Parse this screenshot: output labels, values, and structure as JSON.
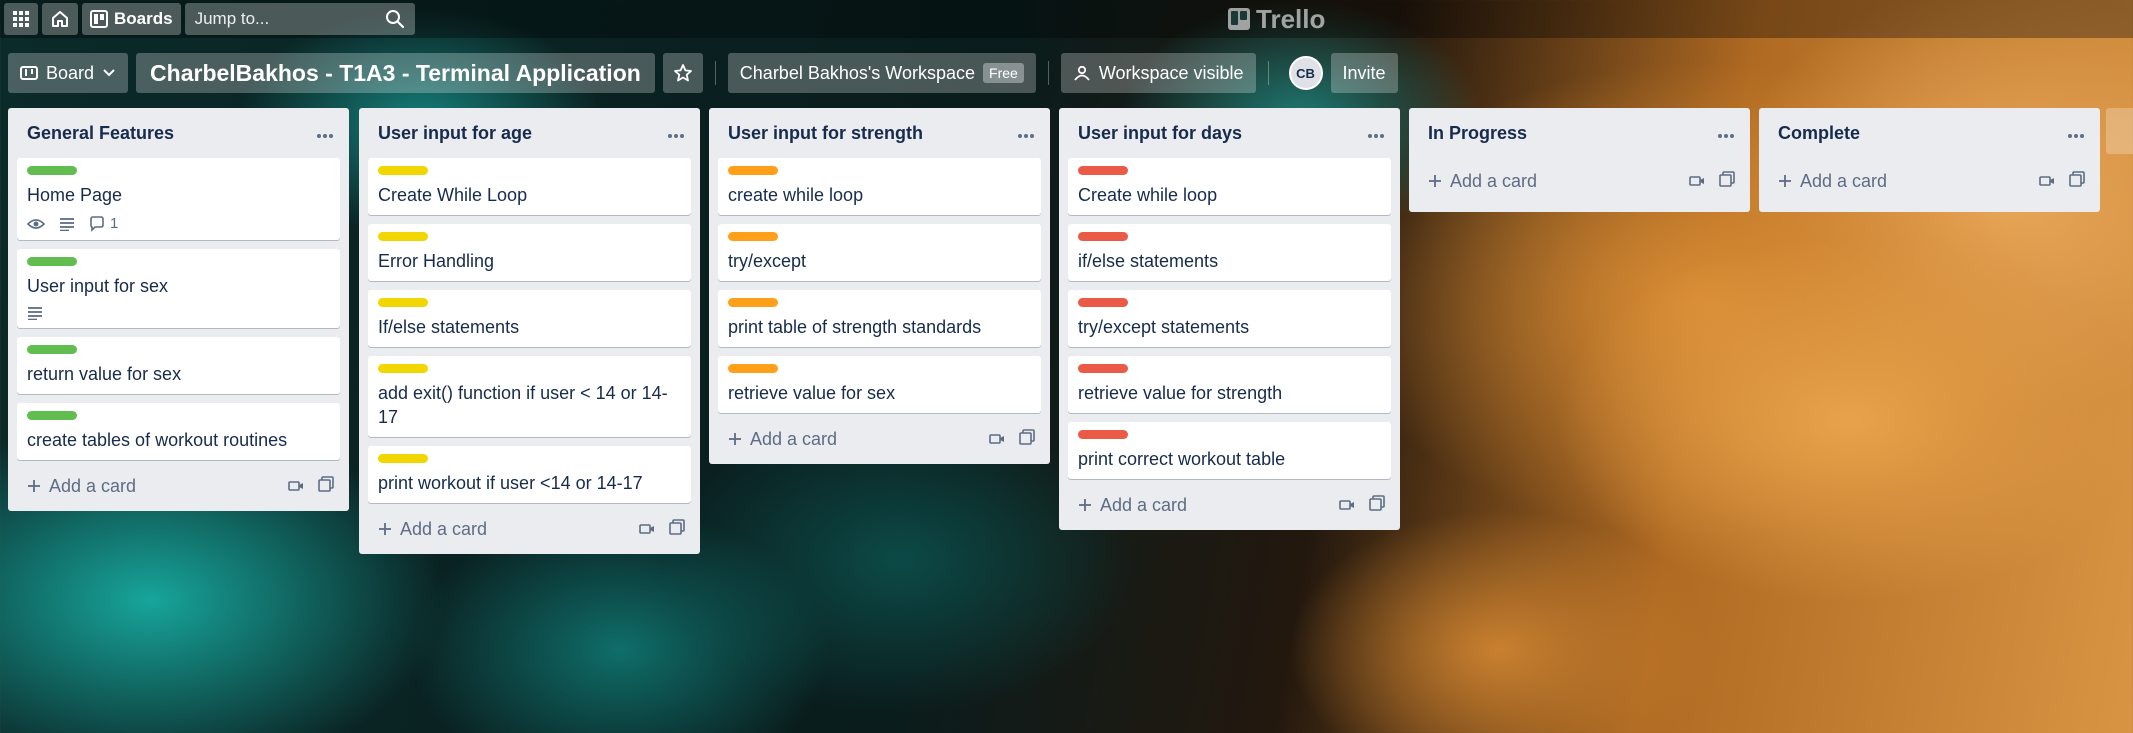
{
  "topbar": {
    "boards_label": "Boards",
    "search_placeholder": "Jump to...",
    "brand": "Trello"
  },
  "boardbar": {
    "view_label": "Board",
    "board_title": "CharbelBakhos - T1A3 - Terminal Application",
    "workspace_name": "Charbel Bakhos's Workspace",
    "workspace_plan": "Free",
    "visibility_label": "Workspace visible",
    "avatar_initials": "CB",
    "invite_label": "Invite"
  },
  "add_card_label": "Add a card",
  "colors": {
    "green": "#61bd4f",
    "yellow": "#f2d600",
    "orange": "#ff9f1a",
    "red": "#eb5a46"
  },
  "lists": [
    {
      "title": "General Features",
      "cards": [
        {
          "title": "Home Page",
          "label": "green",
          "watch": true,
          "description": true,
          "comments": "1"
        },
        {
          "title": "User input for sex",
          "label": "green",
          "description": true
        },
        {
          "title": "return value for sex",
          "label": "green"
        },
        {
          "title": "create tables of workout routines",
          "label": "green"
        }
      ]
    },
    {
      "title": "User input for age",
      "cards": [
        {
          "title": "Create While Loop",
          "label": "yellow"
        },
        {
          "title": "Error Handling",
          "label": "yellow"
        },
        {
          "title": "If/else statements",
          "label": "yellow"
        },
        {
          "title": "add exit() function if user < 14 or 14-17",
          "label": "yellow"
        },
        {
          "title": "print workout if user <14 or 14-17",
          "label": "yellow"
        }
      ]
    },
    {
      "title": "User input for strength",
      "cards": [
        {
          "title": "create while loop",
          "label": "orange"
        },
        {
          "title": "try/except",
          "label": "orange"
        },
        {
          "title": "print table of strength standards",
          "label": "orange"
        },
        {
          "title": "retrieve value for sex",
          "label": "orange"
        }
      ]
    },
    {
      "title": "User input for days",
      "cards": [
        {
          "title": "Create while loop",
          "label": "red"
        },
        {
          "title": "if/else statements",
          "label": "red"
        },
        {
          "title": "try/except statements",
          "label": "red"
        },
        {
          "title": "retrieve value for strength",
          "label": "red"
        },
        {
          "title": "print correct workout table",
          "label": "red"
        }
      ]
    },
    {
      "title": "In Progress",
      "cards": []
    },
    {
      "title": "Complete",
      "cards": []
    }
  ]
}
